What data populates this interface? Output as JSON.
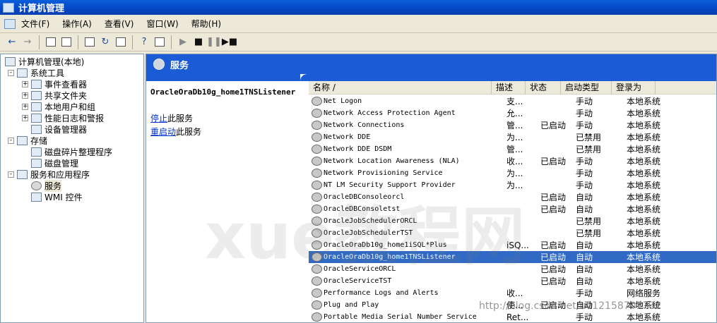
{
  "window": {
    "title": "计算机管理"
  },
  "menu": [
    "文件(F)",
    "操作(A)",
    "查看(V)",
    "窗口(W)",
    "帮助(H)"
  ],
  "toolbar": {
    "icons": [
      "back-arrow-icon",
      "forward-arrow-icon",
      "up-folder-icon",
      "show-hide-tree-icon",
      "properties-icon",
      "refresh-icon",
      "export-list-icon",
      "help-icon",
      "console-tree-icon",
      "start-service-icon",
      "stop-service-icon",
      "pause-service-icon",
      "restart-service-icon"
    ]
  },
  "tree": {
    "root": "计算机管理(本地)",
    "items": [
      {
        "label": "系统工具",
        "expander": "-"
      },
      {
        "label": "事件查看器",
        "expander": "+"
      },
      {
        "label": "共享文件夹",
        "expander": "+"
      },
      {
        "label": "本地用户和组",
        "expander": "+"
      },
      {
        "label": "性能日志和警报",
        "expander": "+"
      },
      {
        "label": "设备管理器",
        "expander": ""
      },
      {
        "label": "存储",
        "expander": "-"
      },
      {
        "label": "磁盘碎片整理程序",
        "expander": ""
      },
      {
        "label": "磁盘管理",
        "expander": ""
      },
      {
        "label": "服务和应用程序",
        "expander": "-"
      },
      {
        "label": "服务",
        "expander": ""
      },
      {
        "label": "WMI 控件",
        "expander": ""
      }
    ]
  },
  "pane": {
    "header": "服务",
    "selected_service": "OracleOraDb10g_home1TNSListener",
    "action_stop_link": "停止",
    "action_stop_text": "此服务",
    "action_restart_link": "重启动",
    "action_restart_text": "此服务"
  },
  "columns": [
    "名称 /",
    "描述",
    "状态",
    "启动类型",
    "登录为"
  ],
  "services": [
    {
      "name": "Net Logon",
      "desc": "支...",
      "status": "",
      "startup": "手动",
      "logon": "本地系统"
    },
    {
      "name": "Network Access Protection Agent",
      "desc": "允...",
      "status": "",
      "startup": "手动",
      "logon": "本地系统"
    },
    {
      "name": "Network Connections",
      "desc": "管...",
      "status": "已启动",
      "startup": "手动",
      "logon": "本地系统"
    },
    {
      "name": "Network DDE",
      "desc": "为...",
      "status": "",
      "startup": "已禁用",
      "logon": "本地系统"
    },
    {
      "name": "Network DDE DSDM",
      "desc": "管...",
      "status": "",
      "startup": "已禁用",
      "logon": "本地系统"
    },
    {
      "name": "Network Location Awareness (NLA)",
      "desc": "收...",
      "status": "已启动",
      "startup": "手动",
      "logon": "本地系统"
    },
    {
      "name": "Network Provisioning Service",
      "desc": "为...",
      "status": "",
      "startup": "手动",
      "logon": "本地系统"
    },
    {
      "name": "NT LM Security Support Provider",
      "desc": "为...",
      "status": "",
      "startup": "手动",
      "logon": "本地系统"
    },
    {
      "name": "OracleDBConsoleorcl",
      "desc": "",
      "status": "已启动",
      "startup": "自动",
      "logon": "本地系统"
    },
    {
      "name": "OracleDBConsoletst",
      "desc": "",
      "status": "已启动",
      "startup": "自动",
      "logon": "本地系统"
    },
    {
      "name": "OracleJobSchedulerORCL",
      "desc": "",
      "status": "",
      "startup": "已禁用",
      "logon": "本地系统"
    },
    {
      "name": "OracleJobSchedulerTST",
      "desc": "",
      "status": "",
      "startup": "已禁用",
      "logon": "本地系统"
    },
    {
      "name": "OracleOraDb10g_home1iSQL*Plus",
      "desc": "iSQ...",
      "status": "已启动",
      "startup": "自动",
      "logon": "本地系统"
    },
    {
      "name": "OracleOraDb10g_home1TNSListener",
      "desc": "",
      "status": "已启动",
      "startup": "自动",
      "logon": "本地系统",
      "selected": true
    },
    {
      "name": "OracleServiceORCL",
      "desc": "",
      "status": "已启动",
      "startup": "自动",
      "logon": "本地系统"
    },
    {
      "name": "OracleServiceTST",
      "desc": "",
      "status": "已启动",
      "startup": "自动",
      "logon": "本地系统"
    },
    {
      "name": "Performance Logs and Alerts",
      "desc": "收...",
      "status": "",
      "startup": "手动",
      "logon": "网络服务"
    },
    {
      "name": "Plug and Play",
      "desc": "使...",
      "status": "已启动",
      "startup": "自动",
      "logon": "本地系统"
    },
    {
      "name": "Portable Media Serial Number Service",
      "desc": "Ret...",
      "status": "",
      "startup": "手动",
      "logon": "本地系统"
    }
  ],
  "watermark": {
    "text": "xue教程网",
    "url": "w3xue.com",
    "blog": "http://blog.csdn.net/u012158703732"
  },
  "colors": {
    "title_bar": "#0447c7",
    "pane_header": "#1c5bd6",
    "selection": "#316ac5",
    "link": "#0033cc"
  }
}
